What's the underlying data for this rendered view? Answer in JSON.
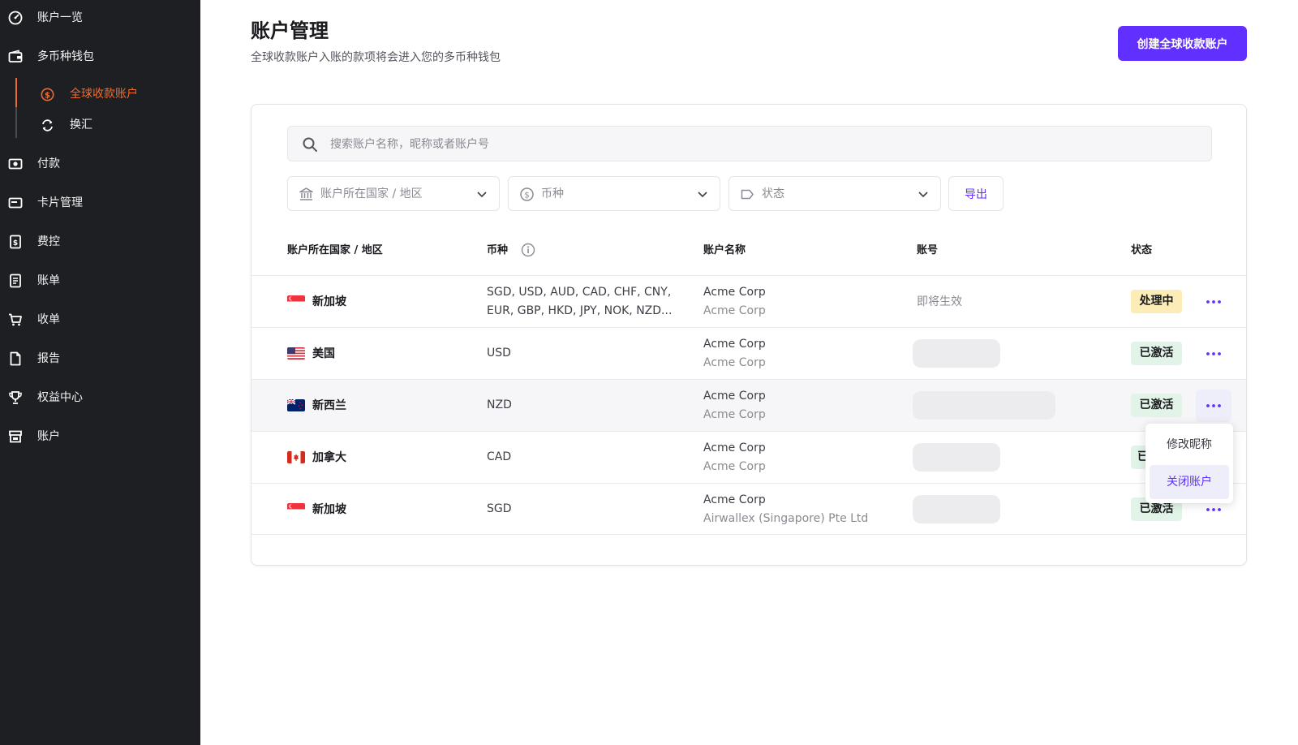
{
  "sidebar": {
    "items": [
      {
        "label": "账户一览",
        "icon": "dashboard-icon"
      },
      {
        "label": "多币种钱包",
        "icon": "wallet-icon"
      },
      {
        "label": "付款",
        "icon": "payment-icon"
      },
      {
        "label": "卡片管理",
        "icon": "card-icon"
      },
      {
        "label": "费控",
        "icon": "expense-icon"
      },
      {
        "label": "账单",
        "icon": "bill-icon"
      },
      {
        "label": "收单",
        "icon": "cart-icon"
      },
      {
        "label": "报告",
        "icon": "report-icon"
      },
      {
        "label": "权益中心",
        "icon": "trophy-icon"
      },
      {
        "label": "账户",
        "icon": "store-icon"
      }
    ],
    "sub_items": [
      {
        "label": "全球收款账户",
        "icon": "dollar-circle-icon",
        "active": true
      },
      {
        "label": "换汇",
        "icon": "exchange-icon",
        "active": false
      }
    ],
    "accent_color": "#f06a2f"
  },
  "header": {
    "title": "账户管理",
    "subtitle": "全球收款账户入账的款项将会进入您的多币种钱包",
    "create_button": "创建全球收款账户"
  },
  "search": {
    "placeholder": "搜索账户名称，昵称或者账户号"
  },
  "filters": {
    "country": "账户所在国家 / 地区",
    "currency": "币种",
    "status": "状态",
    "export": "导出"
  },
  "table": {
    "headers": {
      "country": "账户所在国家 / 地区",
      "currency": "币种",
      "account_name": "账户名称",
      "account_number": "账号",
      "status": "状态"
    },
    "rows": [
      {
        "country": "新加坡",
        "flag": "sg",
        "currency_line1": "SGD, USD, AUD, CAD, CHF, CNY,",
        "currency_line2": "EUR, GBP, HKD, JPY, NOK, NZD...",
        "name": "Acme Corp",
        "nickname": "Acme Corp",
        "account_number": "即将生效",
        "status": "处理中"
      },
      {
        "country": "美国",
        "flag": "us",
        "currency_line1": "USD",
        "currency_line2": "",
        "name": "Acme Corp",
        "nickname": "Acme Corp",
        "account_number": "",
        "status": "已激活"
      },
      {
        "country": "新西兰",
        "flag": "nz",
        "currency_line1": "NZD",
        "currency_line2": "",
        "name": "Acme Corp",
        "nickname": "Acme Corp",
        "account_number": "",
        "status": "已激活"
      },
      {
        "country": "加拿大",
        "flag": "ca",
        "currency_line1": "CAD",
        "currency_line2": "",
        "name": "Acme Corp",
        "nickname": "Acme Corp",
        "account_number": "",
        "status": "已"
      },
      {
        "country": "新加坡",
        "flag": "sg",
        "currency_line1": "SGD",
        "currency_line2": "",
        "name": "Acme Corp",
        "nickname": "Airwallex (Singapore) Pte Ltd",
        "account_number": "",
        "status": "已激活"
      }
    ]
  },
  "row_menu": {
    "items": [
      "修改昵称",
      "关闭账户"
    ]
  },
  "colors": {
    "primary": "#612fff",
    "sidebar_bg": "#1e1f22",
    "processing_badge": "#fcedb6",
    "active_badge": "#e1f4e7"
  }
}
